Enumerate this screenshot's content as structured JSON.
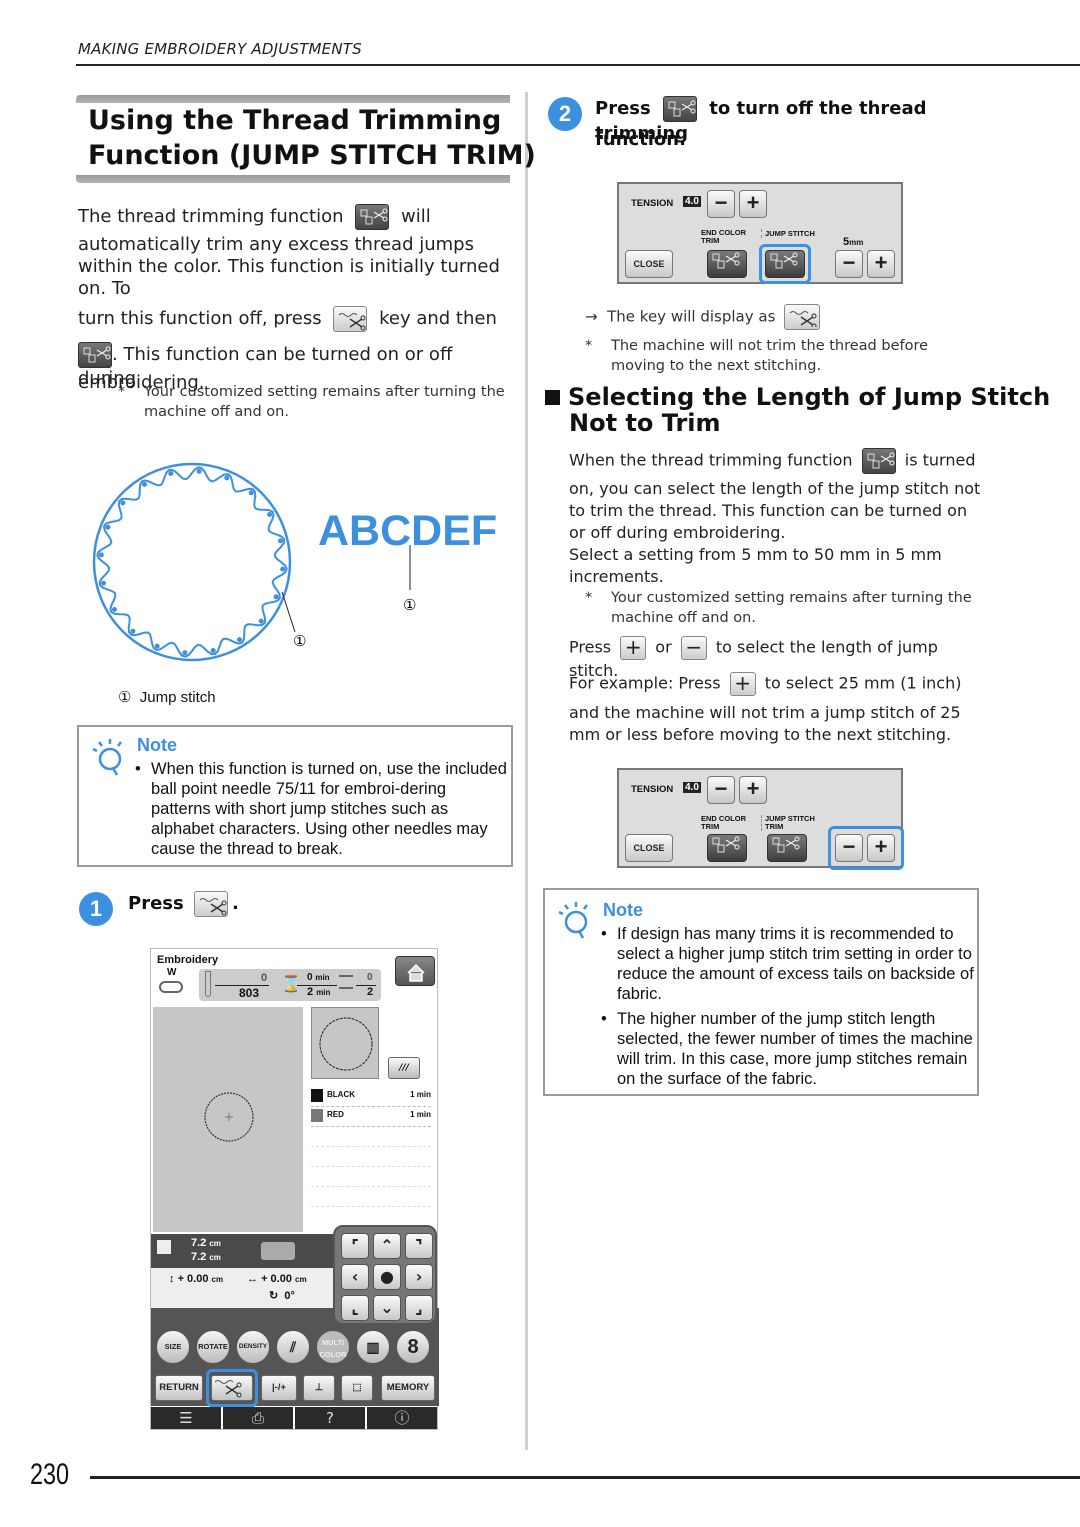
{
  "header": {
    "section_title": "MAKING EMBROIDERY ADJUSTMENTS"
  },
  "main_title": {
    "line1": "Using the Thread Trimming",
    "line2": "Function (JUMP STITCH TRIM)"
  },
  "intro": {
    "p1_a": "The thread trimming function",
    "p1_b": "will",
    "p1_c": "automatically trim any excess thread jumps within the color. This function is initially turned on. To",
    "p2_a": "turn this function off, press",
    "p2_b": "key and then",
    "p3": ". This function can be turned on or off during",
    "p4": "embroidering.",
    "footnote_mark": "*",
    "footnote": "Your customized setting remains after turning the machine off and on."
  },
  "illustration": {
    "lettering": "ABCDEF",
    "callout": "①",
    "legend_mark": "①",
    "legend_text": "Jump stitch",
    "accent_color": "#3d8fe0"
  },
  "note1": {
    "label": "Note",
    "items": [
      "When this function is turned on, use the included ball point needle 75/11 for embroi-dering patterns with short jump stitches such as alphabet characters. Using other needles may cause the thread to break."
    ]
  },
  "step1": {
    "number": "1",
    "press": "Press",
    "period": "."
  },
  "machine_screen": {
    "title": "Embroidery",
    "presser_foot": "W",
    "stitch_current": "0",
    "stitch_total": "803",
    "time_current": "0",
    "time_total": "2",
    "time_unit": "min",
    "color_current": "0",
    "color_total": "2",
    "threads": [
      {
        "name": "BLACK",
        "time": "1 min",
        "color": "#111111"
      },
      {
        "name": "RED",
        "time": "1 min",
        "color": "#777777"
      }
    ],
    "size_w": "7.2",
    "size_h": "7.2",
    "size_unit": "cm",
    "offset_v": "+ 0.00",
    "offset_h": "+ 0.00",
    "offset_unit": "cm",
    "angle": "0°",
    "round_buttons": [
      "SIZE",
      "ROTATE",
      "DENSITY",
      "",
      "MULTI COLOR",
      "",
      "8"
    ],
    "row_buttons": {
      "return": "RETURN",
      "needle": "-/+",
      "memory": "MEMORY"
    },
    "bottom_tabs": [
      "☰",
      "⎙",
      "?",
      "ⓘ"
    ]
  },
  "step2": {
    "number": "2",
    "press": "Press",
    "text": "to turn off the thread trimming",
    "text2": "function."
  },
  "tension_panel": {
    "tension_label": "TENSION",
    "tension_value": "4.0",
    "end_color_trim": "END COLOR TRIM",
    "jump_stitch": "JUMP STITCH",
    "jump_stitch_trim": "JUMP STITCH TRIM",
    "length_value": "5",
    "length_unit": "mm",
    "close": "CLOSE",
    "minus": "−",
    "plus": "+"
  },
  "step2_result": {
    "arrow": "→",
    "text": "The key will display as",
    "footnote_mark": "*",
    "footnote": "The machine will not trim the thread before moving to the next stitching."
  },
  "subsection": {
    "title_line1": "Selecting the Length of Jump Stitch",
    "title_line2": "Not to Trim",
    "p1_a": "When the thread trimming function",
    "p1_b": "is turned",
    "p1_c": "on, you can select the length of the jump stitch not to trim the thread. This function can be turned on or off during embroidering.",
    "p2": "Select a setting from 5 mm to 50 mm in 5 mm increments.",
    "footnote_mark": "*",
    "footnote": "Your customized setting remains after turning the machine off and on.",
    "p3_a": "Press",
    "p3_b": "or",
    "p3_c": "to select the length of jump stitch.",
    "p4_a": "For example: Press",
    "p4_b": "to select 25 mm (1 inch)",
    "p4_c": "and the machine will not trim a jump stitch of 25 mm or less before moving to the next stitching."
  },
  "note2": {
    "label": "Note",
    "items": [
      "If design has many trims it is recommended to select a higher jump stitch trim setting in order to reduce the amount of excess tails on backside of fabric.",
      "The higher number of the jump stitch length selected, the fewer number of times the machine will trim. In this case, more jump stitches remain on the surface of the fabric."
    ]
  },
  "footer": {
    "page_number": "230"
  }
}
